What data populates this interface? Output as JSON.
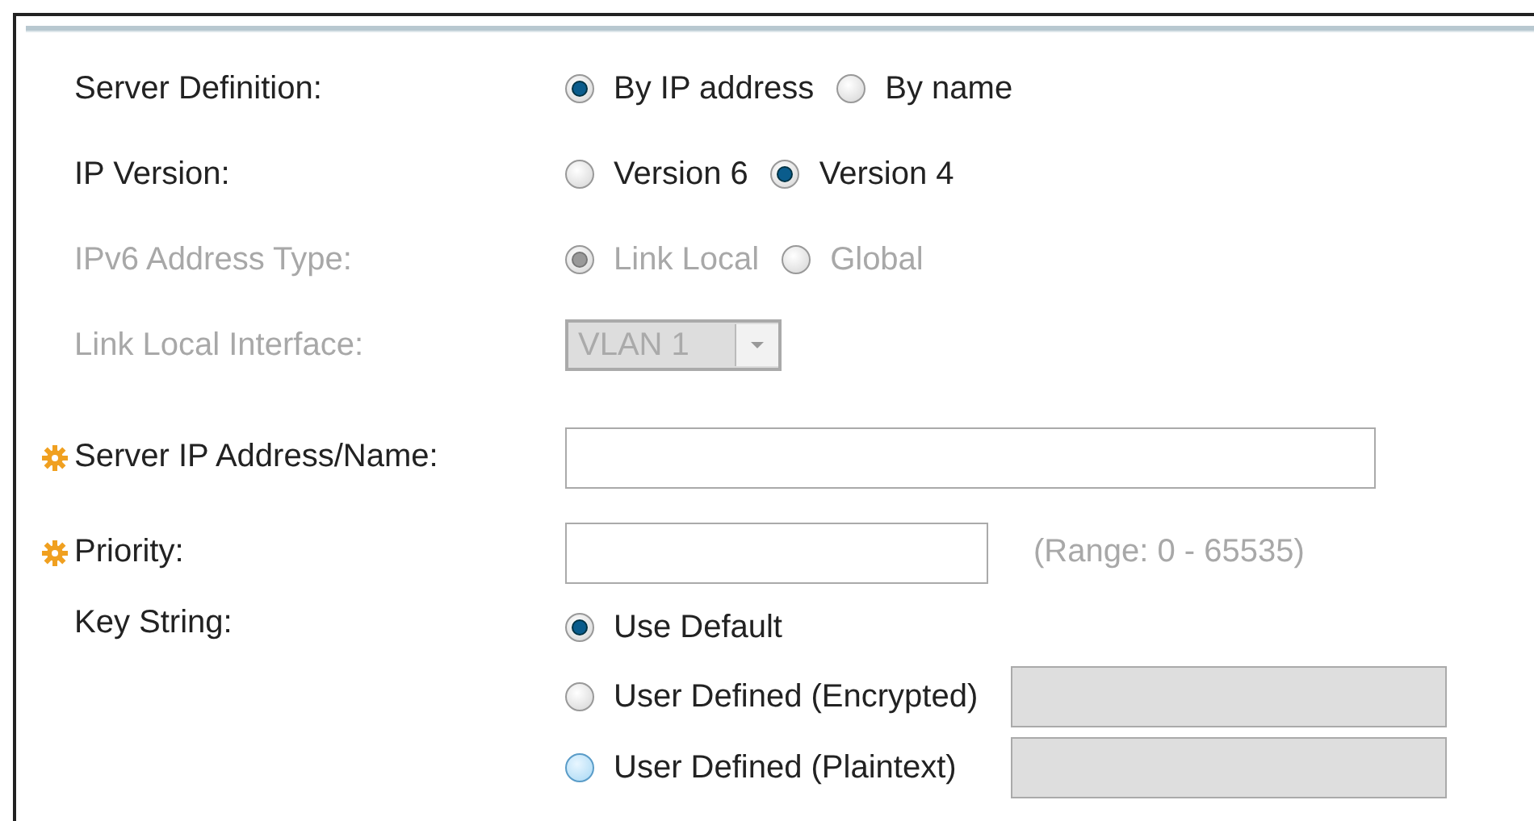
{
  "rows": [
    {
      "kind": "radio",
      "label": "Server Definition:",
      "disabled": false,
      "options": [
        {
          "label": "By IP address",
          "selected": true
        },
        {
          "label": "By name",
          "selected": false
        }
      ]
    },
    {
      "kind": "radio",
      "label": "IP Version:",
      "disabled": false,
      "options": [
        {
          "label": "Version 6",
          "selected": false
        },
        {
          "label": "Version 4",
          "selected": true
        }
      ]
    },
    {
      "kind": "radio",
      "label": "IPv6 Address Type:",
      "disabled": true,
      "options": [
        {
          "label": "Link Local",
          "selected": true
        },
        {
          "label": "Global",
          "selected": false
        }
      ]
    },
    {
      "kind": "select",
      "label": "Link Local Interface:",
      "disabled": true,
      "value": "VLAN 1"
    },
    {
      "kind": "text",
      "label": "Server IP Address/Name:",
      "required": true,
      "disabled": false
    },
    {
      "kind": "text",
      "label": "Priority:",
      "required": true,
      "disabled": false,
      "hint": "(Range: 0 - 65535)"
    },
    {
      "kind": "keys",
      "label": "Key String:",
      "disabled": false,
      "options": [
        {
          "kind": "radio",
          "label": "Use Default",
          "selected": true
        },
        {
          "kind": "radio-field",
          "label": "User Defined (Encrypted)",
          "selected": false
        },
        {
          "kind": "radio-field",
          "label": "User Defined (Plaintext)",
          "selected": false,
          "hover": true
        }
      ]
    }
  ]
}
